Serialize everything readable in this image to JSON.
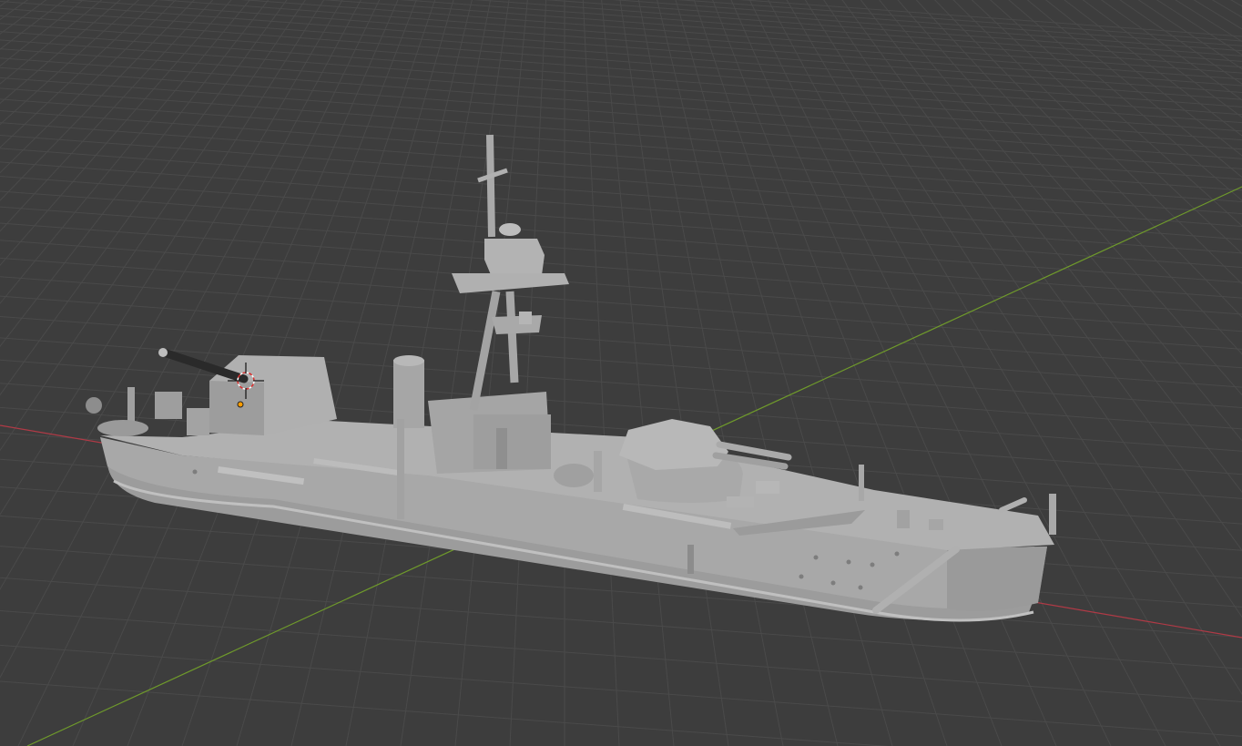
{
  "viewport": {
    "background": "#3d3d3d",
    "grid_color": "#4a4a4a",
    "x_axis_color": "#b03a46",
    "y_axis_color": "#6f9a2b",
    "model_color": "#a7a7a7",
    "model_shadow_color": "#8a8a8a",
    "model_highlight_color": "#bdbdbd",
    "gun_barrel_color": "#2a2a2a",
    "origin_color": "#ff9d00"
  },
  "scene": {
    "object": "ship-model",
    "cursor_icon": "3d-cursor-icon",
    "origin_icon": "object-origin-dot"
  }
}
